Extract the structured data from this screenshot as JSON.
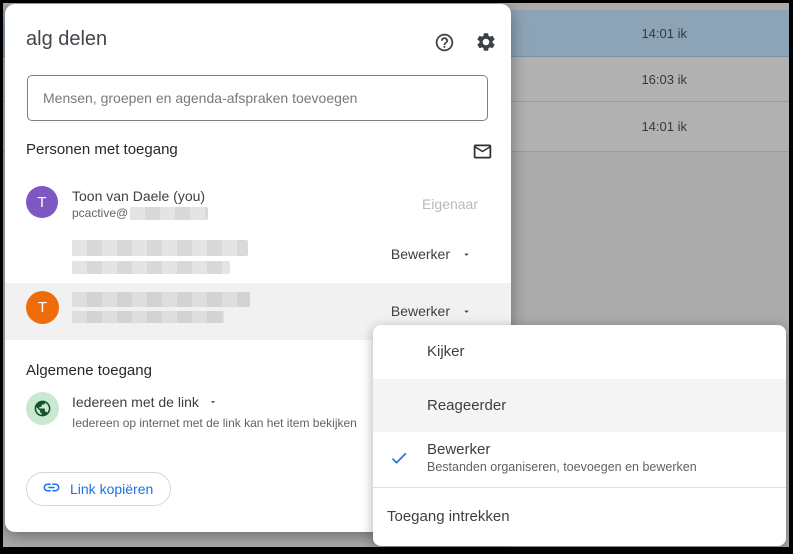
{
  "dialog": {
    "title": "alg delen",
    "search_placeholder": "Mensen, groepen en agenda-afspraken toevoegen",
    "people_section": {
      "title": "Personen met toegang",
      "people": [
        {
          "name": "Toon van Daele (you)",
          "email_prefix": "pcactive@",
          "email_redacted": true,
          "role": "Eigenaar",
          "avatar_letter": "T",
          "avatar_color": "#7e57c2"
        },
        {
          "name_redacted": true,
          "email_redacted": true,
          "role": "Bewerker",
          "avatar": "photo"
        },
        {
          "name_redacted": true,
          "email_redacted": true,
          "role": "Bewerker",
          "avatar_letter": "T",
          "avatar_color": "#ef6c0a",
          "highlighted": true
        }
      ]
    },
    "general_access": {
      "title": "Algemene toegang",
      "access_label": "Iedereen met de link",
      "access_description": "Iedereen op internet met de link kan het item bekijken"
    },
    "copy_link_label": "Link kopiëren"
  },
  "menu": {
    "items": [
      {
        "label": "Kijker"
      },
      {
        "label": "Reageerder",
        "hovered": true
      },
      {
        "label": "Bewerker",
        "checked": true,
        "description": "Bestanden organiseren, toevoegen en bewerken"
      },
      {
        "label": "Toegang intrekken"
      }
    ]
  },
  "background": {
    "rows": [
      {
        "time": "14:01 ik",
        "selected": true
      },
      {
        "time": "16:03 ik",
        "selected": false
      },
      {
        "time": "14:01 ik",
        "selected": false
      }
    ]
  },
  "colors": {
    "accent_blue": "#1a73e8",
    "avatar_purple": "#7e57c2",
    "avatar_orange": "#ef6c0a",
    "access_green_bg": "#c9e9d0",
    "access_green_icon": "#14522e",
    "row_highlight": "#f1f1f1",
    "menu_hover": "#f4f4f5",
    "selected_bg_row": "#8da4b7",
    "background_gray": "#ababab"
  },
  "icons": {
    "help": "question-mark-in-circle",
    "settings": "gear",
    "send_email": "envelope-outline",
    "role_caret": "filled-triangle-down",
    "general_access": "globe",
    "copy_link": "chain-link",
    "selected_role": "checkmark"
  }
}
